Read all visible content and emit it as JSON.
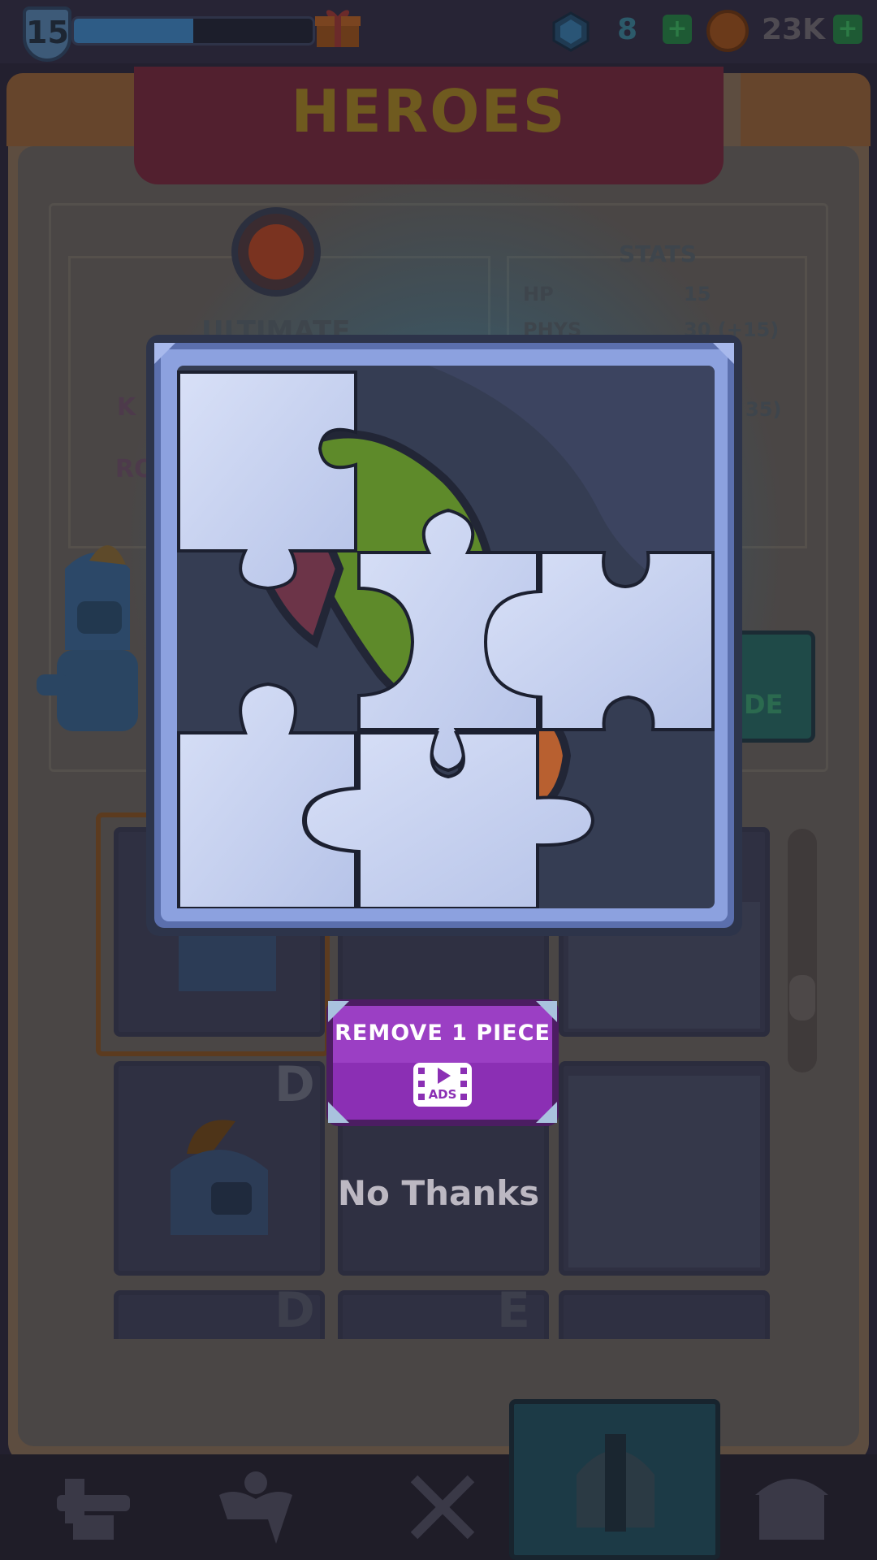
{
  "top_bar": {
    "level": "15",
    "xp_progress": 0.5,
    "gems": "8",
    "coins": "23K",
    "plus_label": "+"
  },
  "background": {
    "screen_title": "HEROES",
    "stats_header": "STATS",
    "ultimate_label": "ULTIMATE",
    "stats": [
      {
        "name": "HP",
        "value": "15"
      },
      {
        "name": "PHYS",
        "value": "30 (+15)"
      }
    ],
    "stat_partial_value": "35)",
    "left_partial_1": "K",
    "left_partial_2": "RO",
    "button_partial": "DE",
    "card_grades": [
      "D",
      "D",
      "E"
    ]
  },
  "modal": {
    "puzzle_pieces_total": 9,
    "puzzle_pieces_remaining": 5,
    "primary_button": "REMOVE 1 PIECE",
    "ads_label": "ADS",
    "secondary_button": "No Thanks"
  },
  "bottom_nav": {
    "items": [
      "forge-icon",
      "training-icon",
      "battle-icon",
      "heroes-icon",
      "shop-icon"
    ],
    "active": "heroes-icon"
  },
  "colors": {
    "cta": "#8b2fb4",
    "piece": "#c7d2f0",
    "frame": "#8ca1df"
  }
}
